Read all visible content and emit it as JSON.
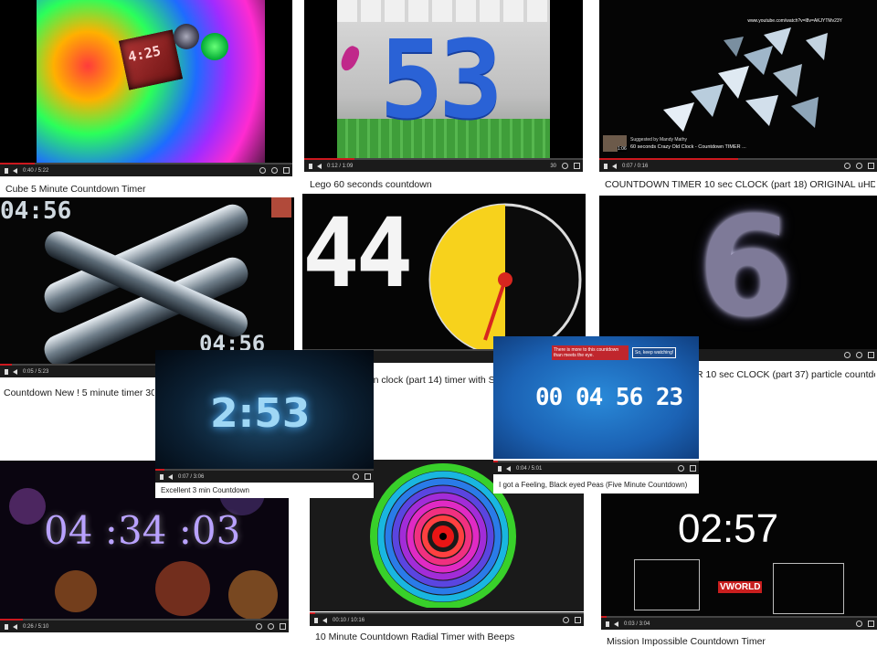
{
  "tiles": {
    "cube": {
      "time": "0:40 / 5:22",
      "caption": "Cube 5 Minute Countdown Timer",
      "screen": "4:25"
    },
    "lego": {
      "time": "0:12 / 1:09",
      "caption": "Lego 60 seconds countdown",
      "digits": "53",
      "count": "30"
    },
    "crazy": {
      "time": "0:07 / 0:16",
      "caption": "COUNTDOWN TIMER 10 sec CLOCK (part 18) ORIGINAL uHD ...",
      "url": "www.youtube.com/watch?v=l8v=AKJYTMv23Y",
      "suggested": "Suggested by Mandy Mathy",
      "suggested_title": "60 seconds Crazy Old Clock - Countdown TIMER ...",
      "thumb_time": "1:06"
    },
    "newtimer": {
      "time": "0:05 / 5:23",
      "caption": "Countdown New ! 5 minute timer 300 s",
      "top_time": "04:56",
      "bottom_time": "04:56"
    },
    "clock": {
      "big": "44",
      "caption": "wn clock (part 14) timer with Sou"
    },
    "particle": {
      "caption": "R 10 sec CLOCK (part 37) particle countdo...",
      "digit": "6"
    },
    "excellent": {
      "time": "0:07 / 3:06",
      "caption": "Excellent 3 min Countdown",
      "display": "2:53"
    },
    "feeling": {
      "time": "0:04 / 5:01",
      "caption": "I got a Feeling, Black eyed Peas (Five Minute Countdown)",
      "display": "00 04 56 23",
      "annot1": "There is more to this countdown than meets the eye.",
      "annot2": "So, keep watching!"
    },
    "bokeh": {
      "time": "0:26 / 5:10",
      "display": "04 :34 :03"
    },
    "radial": {
      "time": "00:10 / 10:16",
      "caption": "10 Minute Countdown Radial Timer with Beeps"
    },
    "mission": {
      "time": "0:03 / 3:04",
      "caption": "Mission Impossible Countdown Timer",
      "display": "02:57",
      "logo": "VWORLD"
    }
  },
  "colors": {
    "progress": "#cc181e",
    "lego_blue": "#2a62d6",
    "lego_yellow": "#f5cf19",
    "clock_yellow": "#f7d21c",
    "clock_red": "#d7261f"
  }
}
